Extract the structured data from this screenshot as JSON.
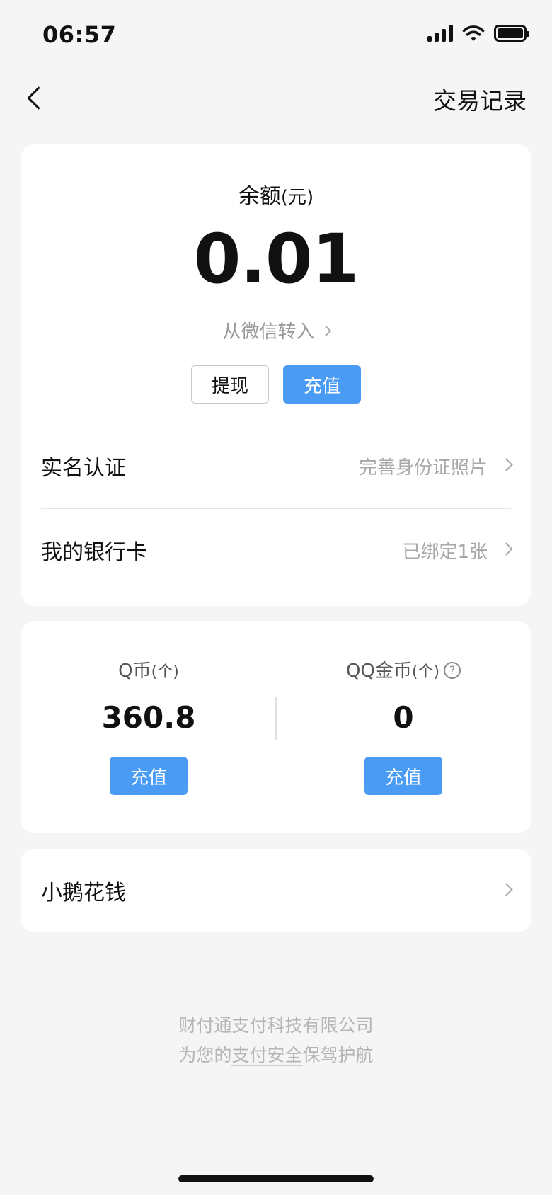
{
  "status_bar": {
    "time": "06:57"
  },
  "nav": {
    "right_action": "交易记录"
  },
  "balance": {
    "label": "余额",
    "unit": "(元)",
    "amount": "0.01",
    "transfer_link": "从微信转入",
    "withdraw_label": "提现",
    "recharge_label": "充值"
  },
  "rows": {
    "realname": {
      "label": "实名认证",
      "value": "完善身份证照片"
    },
    "bank": {
      "label": "我的银行卡",
      "value": "已绑定1张"
    }
  },
  "coins": {
    "qcoin": {
      "label": "Q币",
      "unit": "(个)",
      "value": "360.8",
      "button": "充值"
    },
    "qqgold": {
      "label": "QQ金币",
      "unit": "(个)",
      "value": "0",
      "button": "充值",
      "help": "?"
    }
  },
  "spend": {
    "label": "小鹅花钱"
  },
  "footer": {
    "line1": "财付通支付科技有限公司",
    "line2_prefix": "为您的",
    "line2_underline": "支付安全",
    "line2_suffix": "保驾护航"
  },
  "colors": {
    "accent": "#4a9bf3",
    "background": "#f5f5f5",
    "card": "#ffffff"
  }
}
